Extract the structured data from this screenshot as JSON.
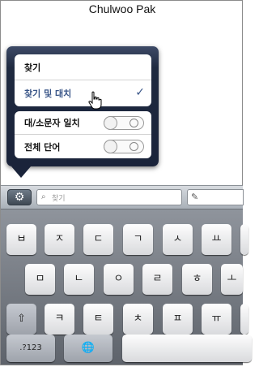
{
  "header": {
    "author": "Chulwoo Pak"
  },
  "popover": {
    "find": "찾기",
    "find_replace": "찾기 및 대치",
    "match_case": "대/소문자 일치",
    "whole_word": "전체 단어",
    "checkmark": "✓"
  },
  "toolbar": {
    "search_placeholder": "찾기",
    "gear_icon": "⚙",
    "search_icon": "⌕",
    "pencil_icon": "✎"
  },
  "keyboard": {
    "row1": [
      "ㅂ",
      "ㅈ",
      "ㄷ",
      "ㄱ",
      "ㅅ",
      "ㅛ"
    ],
    "row2": [
      "ㅁ",
      "ㄴ",
      "ㅇ",
      "ㄹ",
      "ㅎ",
      "ㅗ"
    ],
    "row3": [
      "ㅋ",
      "ㅌ",
      "ㅊ",
      "ㅍ",
      "ㅠ"
    ],
    "shift": "⇧",
    "numbers": ".?123",
    "globe": "🌐"
  }
}
